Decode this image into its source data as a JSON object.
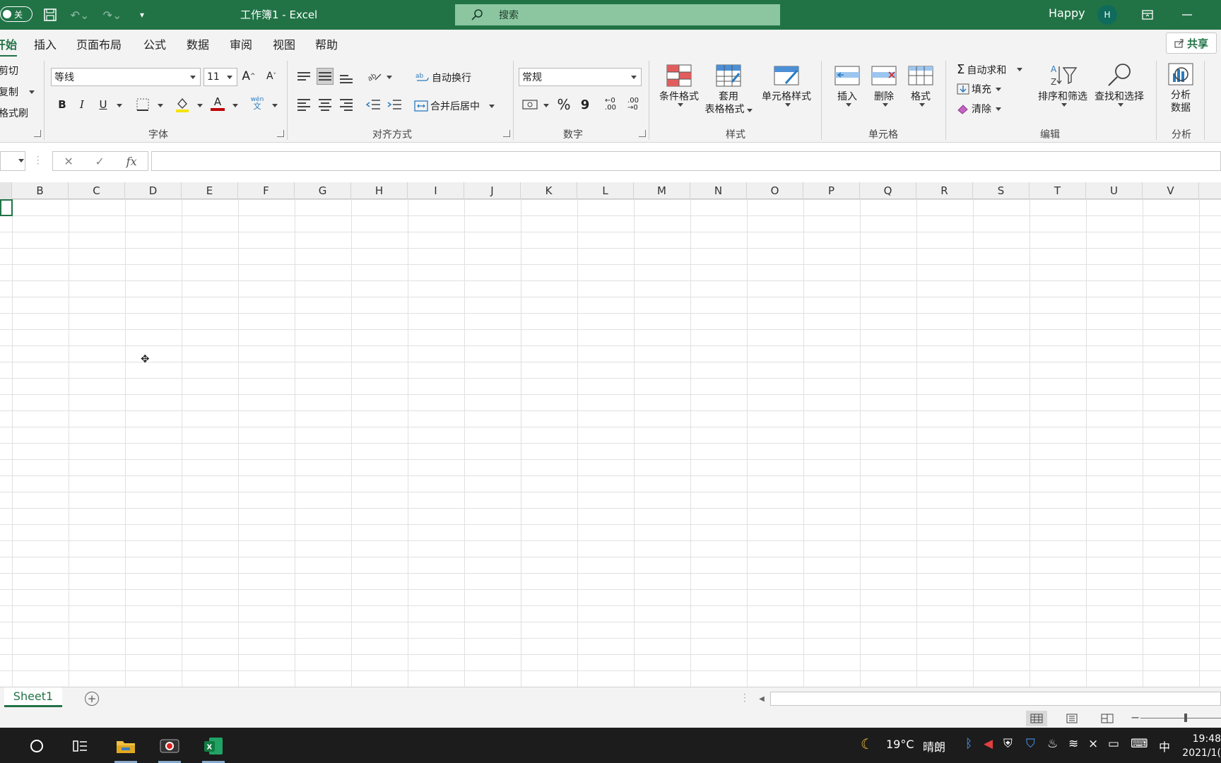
{
  "window": {
    "autosave_label": "关",
    "title": "工作簿1  -  Excel",
    "search_placeholder": "搜索",
    "user_name": "Happy",
    "user_initial": "H"
  },
  "tabs": [
    {
      "label": "开始",
      "visible_label": "开始",
      "active": true
    },
    {
      "label": "插入"
    },
    {
      "label": "页面布局"
    },
    {
      "label": "公式"
    },
    {
      "label": "数据"
    },
    {
      "label": "审阅"
    },
    {
      "label": "视图"
    },
    {
      "label": "帮助"
    }
  ],
  "share_label": "共享",
  "ribbon": {
    "clipboard": {
      "cut": "剪切",
      "copy": "复制",
      "format_painter": "格式刷"
    },
    "font": {
      "name": "等线",
      "size": "11",
      "bold": "B",
      "italic": "I",
      "underline": "U",
      "font_color_letter": "A",
      "phonetic": "wén",
      "phonetic_char": "文",
      "label": "字体"
    },
    "alignment": {
      "wrap": "自动换行",
      "merge": "合并后居中",
      "label": "对齐方式"
    },
    "number": {
      "format": "常规",
      "percent": "%",
      "comma": "9",
      "label": "数字"
    },
    "styles": {
      "conditional": "条件格式",
      "table_line1": "套用",
      "table_line2": "表格格式",
      "cell_styles": "单元格样式",
      "label": "样式"
    },
    "cells": {
      "insert": "插入",
      "delete": "删除",
      "format": "格式",
      "label": "单元格"
    },
    "editing": {
      "autosum": "自动求和",
      "fill": "填充",
      "clear": "清除",
      "sort_filter": "排序和筛选",
      "find_select": "查找和选择",
      "label": "编辑"
    },
    "analysis": {
      "line1": "分析",
      "line2": "数据",
      "label": "分析"
    }
  },
  "formula_bar": {
    "fx": "fx",
    "cancel": "✕",
    "enter": "✓"
  },
  "columns": [
    "B",
    "C",
    "D",
    "E",
    "F",
    "G",
    "H",
    "I",
    "J",
    "K",
    "L",
    "M",
    "N",
    "O",
    "P",
    "Q",
    "R",
    "S",
    "T",
    "U",
    "V"
  ],
  "sheet": {
    "tab": "Sheet1",
    "add": "+"
  },
  "taskbar": {
    "weather_temp": "19°C",
    "weather_desc": "晴朗",
    "ime": "中",
    "time": "19:48",
    "date": "2021/1("
  },
  "colors": {
    "accent": "#217346",
    "title_bg": "#217346",
    "search_bg": "#8bc6a0"
  }
}
